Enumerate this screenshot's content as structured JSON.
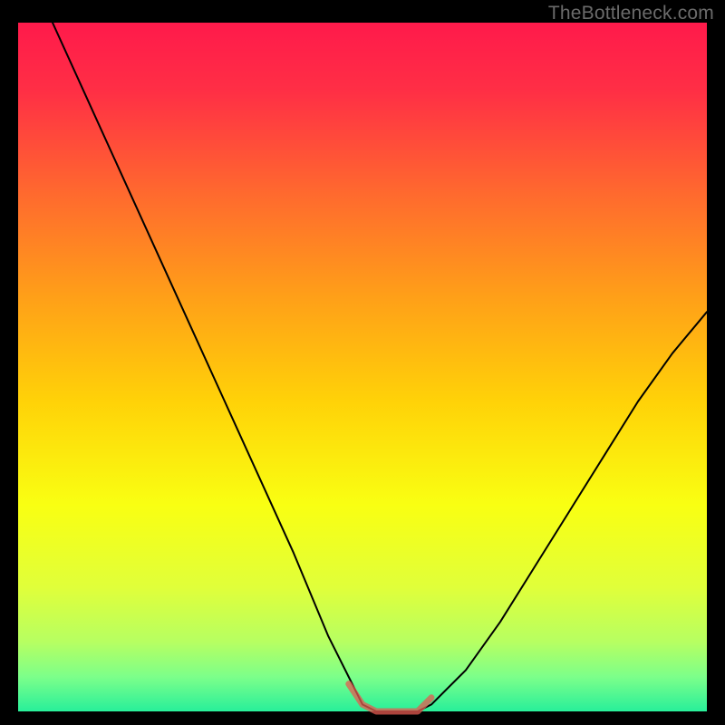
{
  "watermark": "TheBottleneck.com",
  "chart_data": {
    "type": "line",
    "title": "",
    "xlabel": "",
    "ylabel": "",
    "xlim": [
      0,
      100
    ],
    "ylim": [
      0,
      100
    ],
    "grid": false,
    "description": "V-shaped optimum curve over a vertical red-to-yellow-to-green gradient. Black curve descends steeply from top-left to a flat minimum around x≈50–58, then rises toward the right. A short translucent red segment highlights the flat minimum.",
    "gradient_stops": [
      {
        "offset": 0.0,
        "color": "#ff1a4b"
      },
      {
        "offset": 0.1,
        "color": "#ff2f45"
      },
      {
        "offset": 0.25,
        "color": "#ff6a2e"
      },
      {
        "offset": 0.4,
        "color": "#ffa018"
      },
      {
        "offset": 0.55,
        "color": "#ffd208"
      },
      {
        "offset": 0.7,
        "color": "#f9ff12"
      },
      {
        "offset": 0.82,
        "color": "#e0ff3a"
      },
      {
        "offset": 0.9,
        "color": "#b6ff62"
      },
      {
        "offset": 0.95,
        "color": "#7cff8a"
      },
      {
        "offset": 1.0,
        "color": "#28ef9a"
      }
    ],
    "series": [
      {
        "name": "bottleneck-curve",
        "color": "#000000",
        "stroke_width": 2.0,
        "x": [
          5,
          10,
          15,
          20,
          25,
          30,
          35,
          40,
          45,
          48,
          50,
          52,
          54,
          56,
          58,
          60,
          65,
          70,
          75,
          80,
          85,
          90,
          95,
          100
        ],
        "y": [
          100,
          89,
          78,
          67,
          56,
          45,
          34,
          23,
          11,
          5,
          1,
          0,
          0,
          0,
          0,
          1,
          6,
          13,
          21,
          29,
          37,
          45,
          52,
          58
        ]
      },
      {
        "name": "optimal-zone-highlight",
        "color": "rgba(230,90,80,0.75)",
        "stroke_width": 7.0,
        "x": [
          48,
          50,
          52,
          54,
          56,
          58,
          60
        ],
        "y": [
          4,
          1,
          0,
          0,
          0,
          0,
          2
        ]
      }
    ]
  }
}
